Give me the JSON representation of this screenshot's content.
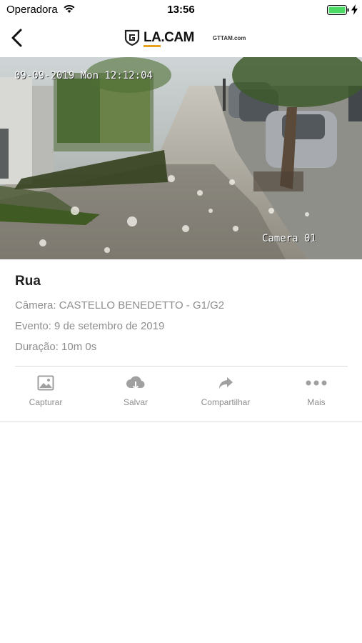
{
  "status_bar": {
    "carrier": "Operadora",
    "time": "13:56"
  },
  "nav": {
    "logo_text_a": "LA",
    "logo_text_b": ".CAM",
    "logo_site": "GTTAM.com",
    "icons": {
      "back": "chevron-left-icon",
      "logo": "shield-g-logo"
    }
  },
  "camera": {
    "timestamp": "09-09-2019 Mon 12:12:04",
    "name": "Camera 01"
  },
  "event": {
    "title": "Rua",
    "camera_line": "Câmera: CASTELLO BENEDETTO - G1/G2",
    "event_line": "Evento: 9 de setembro de 2019",
    "duration_line": "Duração: 10m 0s"
  },
  "actions": [
    {
      "label": "Capturar",
      "icon": "image-icon"
    },
    {
      "label": "Salvar",
      "icon": "cloud-download-icon"
    },
    {
      "label": "Compartilhar",
      "icon": "share-arrow-icon"
    },
    {
      "label": "Mais",
      "icon": "more-dots-icon"
    }
  ],
  "colors": {
    "accent": "#e6a21c",
    "muted_text": "#8e8e8e",
    "icon_gray": "#a0a0a0",
    "divider": "#d9d9d9"
  }
}
